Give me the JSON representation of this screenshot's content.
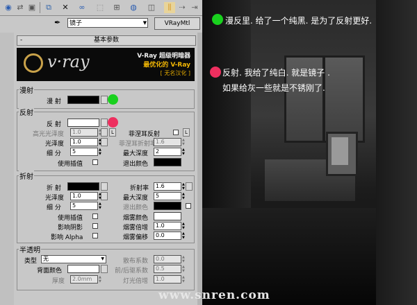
{
  "toolbar": {
    "icons": [
      "get-material-icon",
      "put-to-scene-icon",
      "assign-icon",
      "reset-icon",
      "make-copy-icon",
      "unique-icon",
      "put-library-icon",
      "mat-id-icon",
      "show-map-icon",
      "show-end-icon",
      "go-parent-icon",
      "go-sibling-icon"
    ]
  },
  "namebar": {
    "material_name": "镜子",
    "material_type": "VRayMtl"
  },
  "rollout": {
    "title": "基本参数",
    "collapse": "-"
  },
  "banner": {
    "logo": "v·ray",
    "line1": "V-Ray 超级明暗器",
    "line2": "最优化的 V-Ray",
    "line3": "[ 无名汉化 ]"
  },
  "diffuse": {
    "title": "漫射",
    "label": "漫  射",
    "color": "#000000"
  },
  "reflection": {
    "title": "反射",
    "label": "反  射",
    "color": "#ffffff",
    "hilight_gloss_label": "高光光泽度",
    "hilight_gloss": "1.0",
    "lock_label": "L",
    "fresnel_label": "菲涅耳反射",
    "fresnel_lock_label": "L",
    "fresnel_ior_label": "菲涅耳折射率",
    "fresnel_ior": "1.6",
    "gloss_label": "光泽度",
    "gloss": "1.0",
    "max_depth_label": "最大深度",
    "max_depth": "2",
    "subdivs_label": "细  分",
    "subdivs": "5",
    "exit_color_label": "退出颜色",
    "exit_color": "#000000",
    "interp_label": "使用插值"
  },
  "refraction": {
    "title": "折射",
    "label": "折  射",
    "color": "#000000",
    "ior_label": "折射率",
    "ior": "1.6",
    "gloss_label": "光泽度",
    "gloss": "1.0",
    "max_depth_label": "最大深度",
    "max_depth": "5",
    "subdivs_label": "细  分",
    "subdivs": "5",
    "exit_color_label": "退出颜色",
    "exit_color": "#000000",
    "interp_label": "使用插值",
    "fog_color_label": "烟雾颜色",
    "fog_color": "#ffffff",
    "shadows_label": "影响阴影",
    "fog_mult_label": "烟雾倍增",
    "fog_mult": "1.0",
    "alpha_label": "影响 Alpha",
    "fog_bias_label": "烟雾偏移",
    "fog_bias": "0.0"
  },
  "translucency": {
    "title": "半透明",
    "type_label": "类型",
    "type_value": "无",
    "scatter_label": "散布系数",
    "scatter": "0.0",
    "back_color_label": "背面颜色",
    "back_color": "#ffffff",
    "fb_label": "前/后驱系数",
    "fb": "0.5",
    "thickness_label": "厚度",
    "thickness": "2.0mm",
    "light_mult_label": "灯光倍增",
    "light_mult": "1.0"
  },
  "annotations": {
    "green_note": "漫反里. 给了一个纯黑. 是为了反射更好.",
    "red_note_1": "反射. 我给了纯白. 就是镜子 .",
    "red_note_2": "如果给灰一些就是不锈刚了.",
    "green": "#19d11e",
    "red": "#ee2f5f"
  },
  "watermark": "www.snren.com"
}
